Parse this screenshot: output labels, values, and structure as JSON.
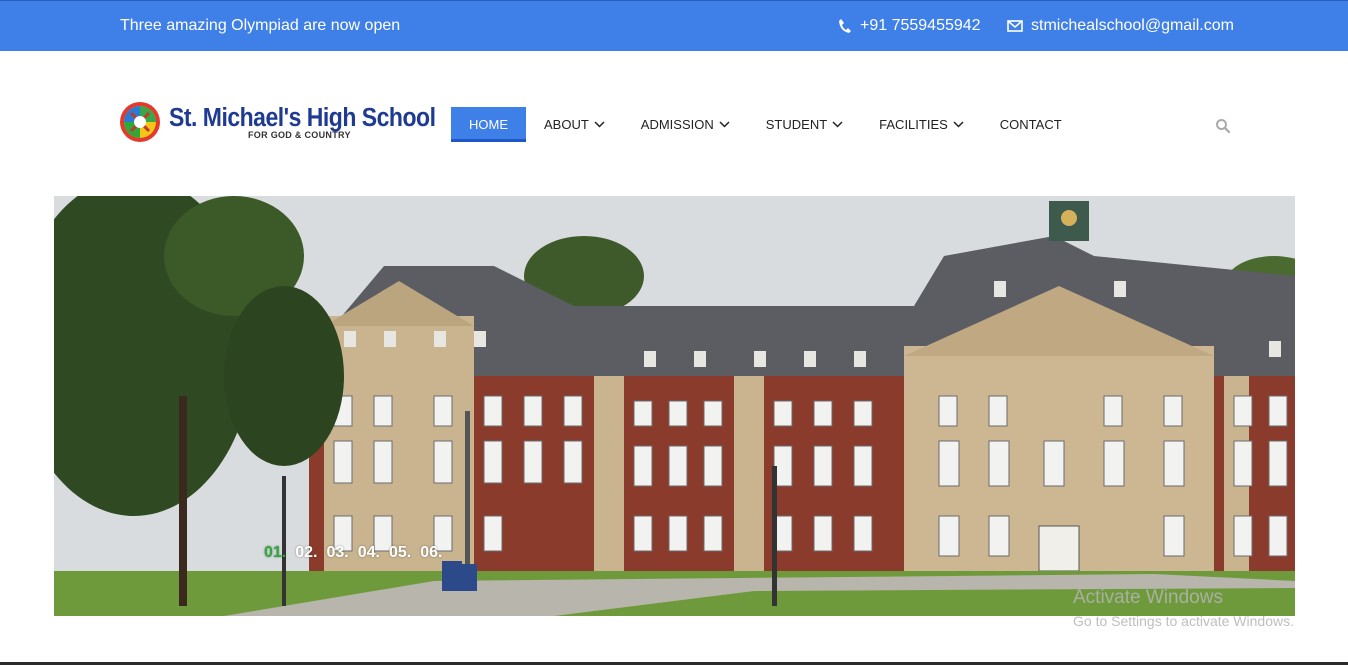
{
  "topbar": {
    "notice": "Three amazing Olympiad are now open",
    "phone": "+91 7559455942",
    "email": "stmichealschool@gmail.com",
    "bg_color": "#3f7fe8"
  },
  "logo": {
    "title": "St. Michael's High School",
    "tagline": "FOR GOD & COUNTRY"
  },
  "nav": {
    "items": [
      {
        "label": "HOME",
        "active": true,
        "dropdown": false
      },
      {
        "label": "ABOUT",
        "dropdown": true
      },
      {
        "label": "ADMISSION",
        "dropdown": true
      },
      {
        "label": "STUDENT",
        "dropdown": true
      },
      {
        "label": "FACILITIES",
        "dropdown": true
      },
      {
        "label": "CONTACT",
        "dropdown": false
      }
    ],
    "search_icon": "search-icon"
  },
  "hero": {
    "slides": [
      "01.",
      "02.",
      "03.",
      "04.",
      "05.",
      "06."
    ],
    "active_slide": 0,
    "active_color": "#2fa83a"
  },
  "watermark": {
    "title": "Activate Windows",
    "subtitle": "Go to Settings to activate Windows."
  }
}
